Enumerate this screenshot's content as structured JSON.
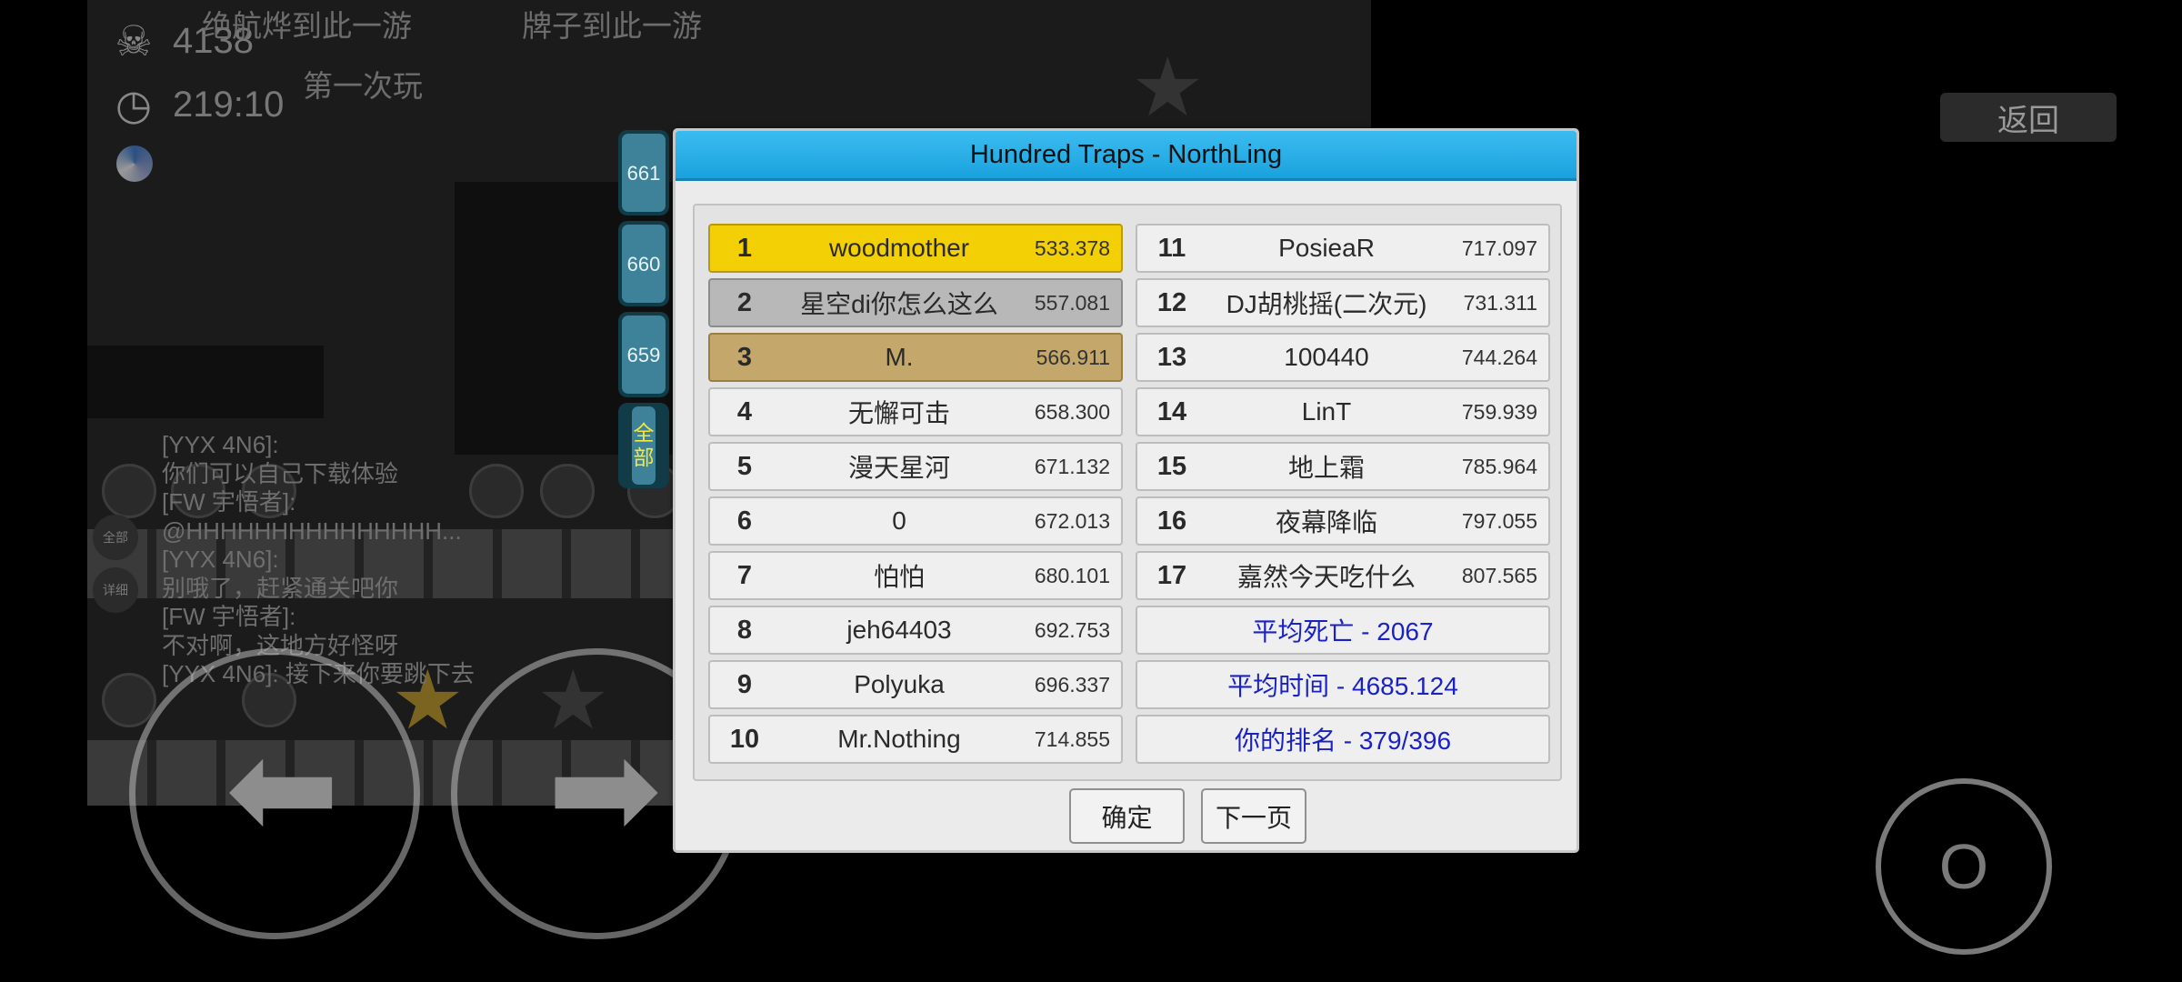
{
  "hud": {
    "deaths": "4138",
    "time": "219:10",
    "banner_left": "绝航烨到此一游",
    "banner_right": "牌子到此一游",
    "sign_text": "第一次玩"
  },
  "chat": {
    "lines": [
      "[YYX 4N6]:",
      "你们可以自己下载体验",
      "[FW 宇悟者]:",
      "@HHHHHHHHHHHHHHH...",
      "[YYX 4N6]:",
      "别哦了，赶紧通关吧你",
      "[FW 宇悟者]:",
      "不对啊，这地方好怪呀",
      "[YYX 4N6]: 接下来你要跳下去"
    ],
    "tab_all": "全部",
    "tab_detail": "详细"
  },
  "controls": {
    "back_label": "返回",
    "action_label": "O"
  },
  "side_tabs": [
    "661",
    "660",
    "659",
    "全部"
  ],
  "dialog": {
    "title": "Hundred Traps - NorthLing",
    "confirm_label": "确定",
    "next_label": "下一页",
    "leaderboard": [
      {
        "rank": "1",
        "name": "woodmother",
        "score": "533.378"
      },
      {
        "rank": "2",
        "name": "星空di你怎么这么",
        "score": "557.081"
      },
      {
        "rank": "3",
        "name": "M.",
        "score": "566.911"
      },
      {
        "rank": "4",
        "name": "无懈可击",
        "score": "658.300"
      },
      {
        "rank": "5",
        "name": "漫天星河",
        "score": "671.132"
      },
      {
        "rank": "6",
        "name": "0",
        "score": "672.013"
      },
      {
        "rank": "7",
        "name": "怕怕",
        "score": "680.101"
      },
      {
        "rank": "8",
        "name": "jeh64403",
        "score": "692.753"
      },
      {
        "rank": "9",
        "name": "Polyuka",
        "score": "696.337"
      },
      {
        "rank": "10",
        "name": "Mr.Nothing",
        "score": "714.855"
      },
      {
        "rank": "11",
        "name": "PosieaR",
        "score": "717.097"
      },
      {
        "rank": "12",
        "name": "DJ胡桃摇(二次元)",
        "score": "731.311"
      },
      {
        "rank": "13",
        "name": "100440",
        "score": "744.264"
      },
      {
        "rank": "14",
        "name": "LinT",
        "score": "759.939"
      },
      {
        "rank": "15",
        "name": "地上霜",
        "score": "785.964"
      },
      {
        "rank": "16",
        "name": "夜幕降临",
        "score": "797.055"
      },
      {
        "rank": "17",
        "name": "嘉然今天吃什么",
        "score": "807.565"
      }
    ],
    "stats": {
      "avg_deaths": "平均死亡 - 2067",
      "avg_time": "平均时间 - 4685.124",
      "your_rank": "你的排名 - 379/396"
    }
  },
  "colors": {
    "title_bar": "#1aa2de",
    "gold": "#f3cf05",
    "silver": "#b8b8b8",
    "bronze": "#c4a76a",
    "stat_text": "#1a22c4"
  }
}
